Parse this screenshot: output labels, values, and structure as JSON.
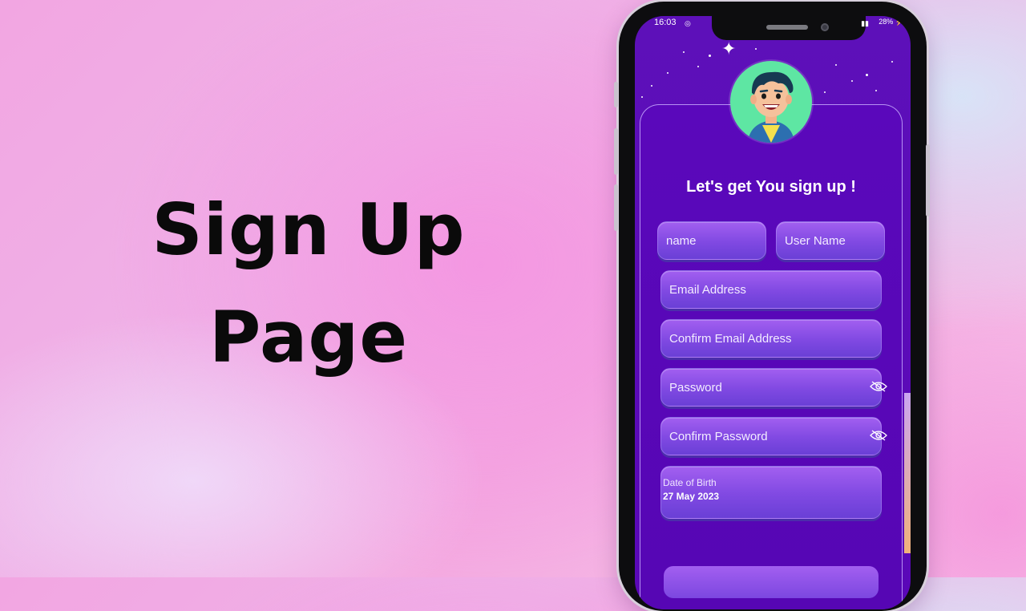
{
  "headline": {
    "line1": "Sign Up",
    "line2": "Page"
  },
  "status_bar": {
    "time": "16:03",
    "battery": "28%"
  },
  "form": {
    "title": "Let's get You sign up !",
    "name_placeholder": "name",
    "username_placeholder": "User Name",
    "email_placeholder": "Email Address",
    "confirm_email_placeholder": "Confirm Email Address",
    "password_placeholder": "Password",
    "confirm_password_placeholder": "Confirm Password",
    "dob_label": "Date of Birth",
    "dob_value": "27 May 2023"
  },
  "colors": {
    "screen_bg": "#5a07b8",
    "field_top": "#a25ff0",
    "field_bottom": "#6a3fd6",
    "avatar_bg": "#5ee6a3"
  }
}
